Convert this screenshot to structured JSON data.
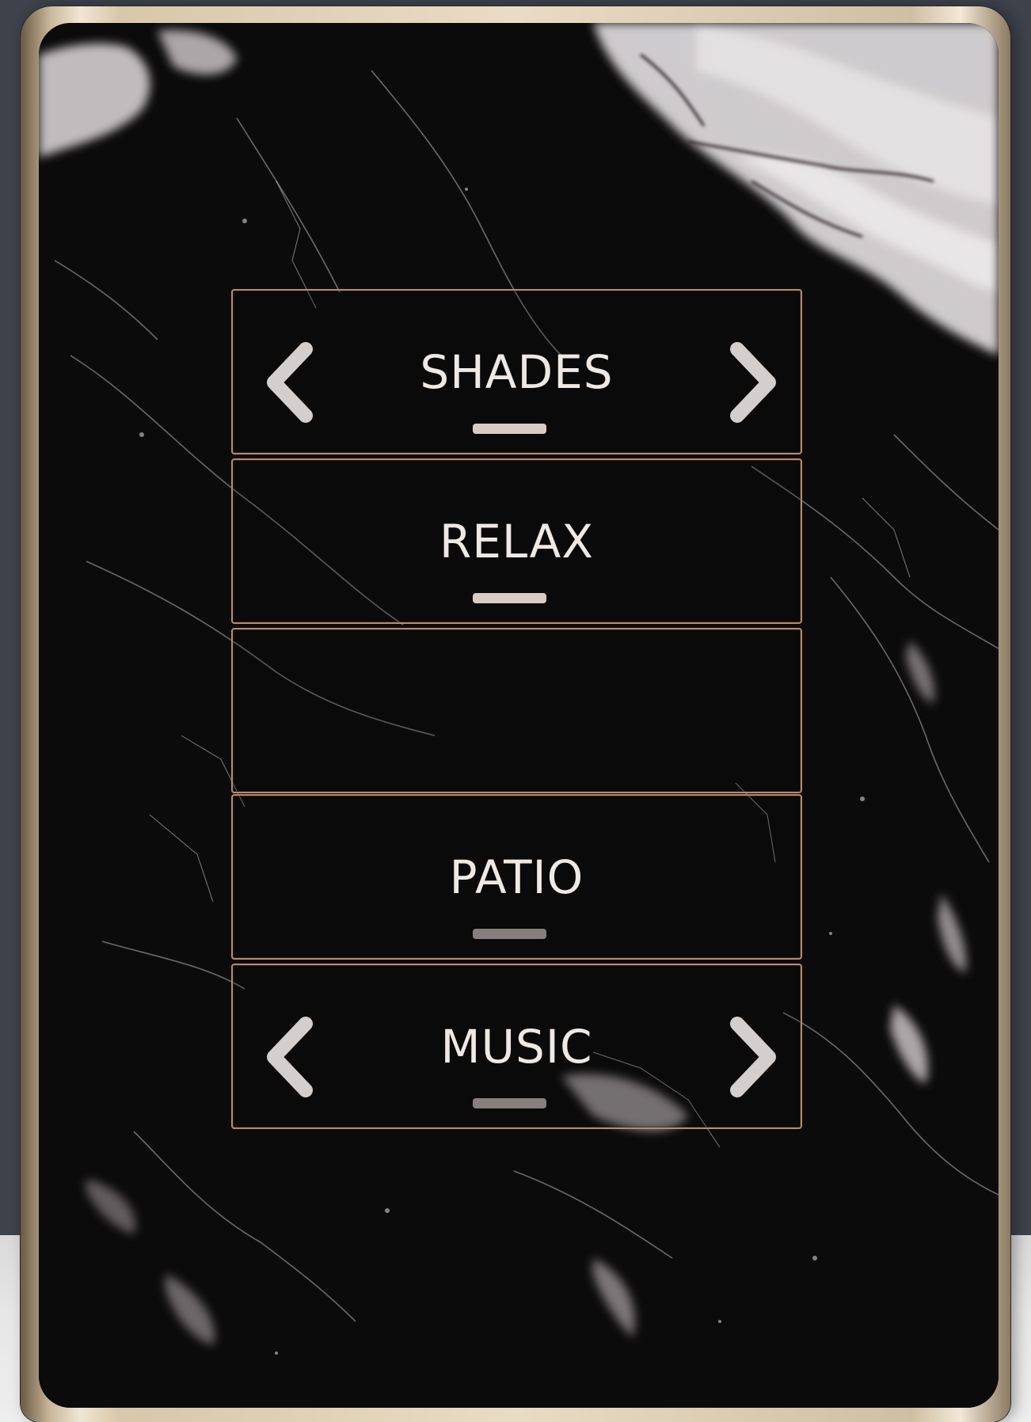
{
  "keypad": {
    "keys": [
      {
        "label": "SHADES",
        "indicator": "on",
        "has_arrows": true
      },
      {
        "label": "RELAX",
        "indicator": "on",
        "has_arrows": false
      },
      {
        "label": "",
        "indicator": "none",
        "has_arrows": false
      },
      {
        "label": "PATIO",
        "indicator": "off",
        "has_arrows": false
      },
      {
        "label": "MUSIC",
        "indicator": "off",
        "has_arrows": true
      }
    ]
  },
  "icons": {
    "left_arrow": "chevron-left-icon",
    "right_arrow": "chevron-right-icon"
  },
  "colors": {
    "key_border": "#b88a6e",
    "label_text": "#efe9e4",
    "indicator_on": "#d9ccc5",
    "indicator_off": "#85807d",
    "plate": "#0c0b0c",
    "frame": "#e9dcc4",
    "background": "#3d424b"
  }
}
